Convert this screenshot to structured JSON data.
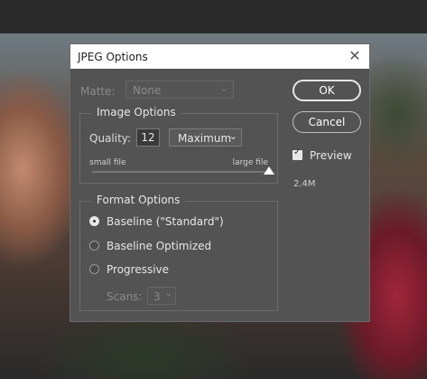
{
  "dialog": {
    "title": "JPEG Options",
    "close_glyph": "✕",
    "matte": {
      "label": "Matte:",
      "value": "None"
    },
    "image_options": {
      "title": "Image Options",
      "quality_label": "Quality:",
      "quality_value": "12",
      "quality_preset": "Maximum",
      "small_file": "small file",
      "large_file": "large file",
      "slider_level_fraction": 1.0
    },
    "format_options": {
      "title": "Format Options",
      "baseline_standard": "Baseline (\"Standard\")",
      "baseline_optimized": "Baseline Optimized",
      "progressive": "Progressive",
      "selected": "baseline_standard",
      "scans_label": "Scans:",
      "scans_value": "3"
    },
    "buttons": {
      "ok": "OK",
      "cancel": "Cancel"
    },
    "preview": {
      "label": "Preview",
      "checked": true
    },
    "file_size": "2.4M"
  },
  "icons": {
    "chevron": "⌄",
    "checkmark": "✓"
  }
}
